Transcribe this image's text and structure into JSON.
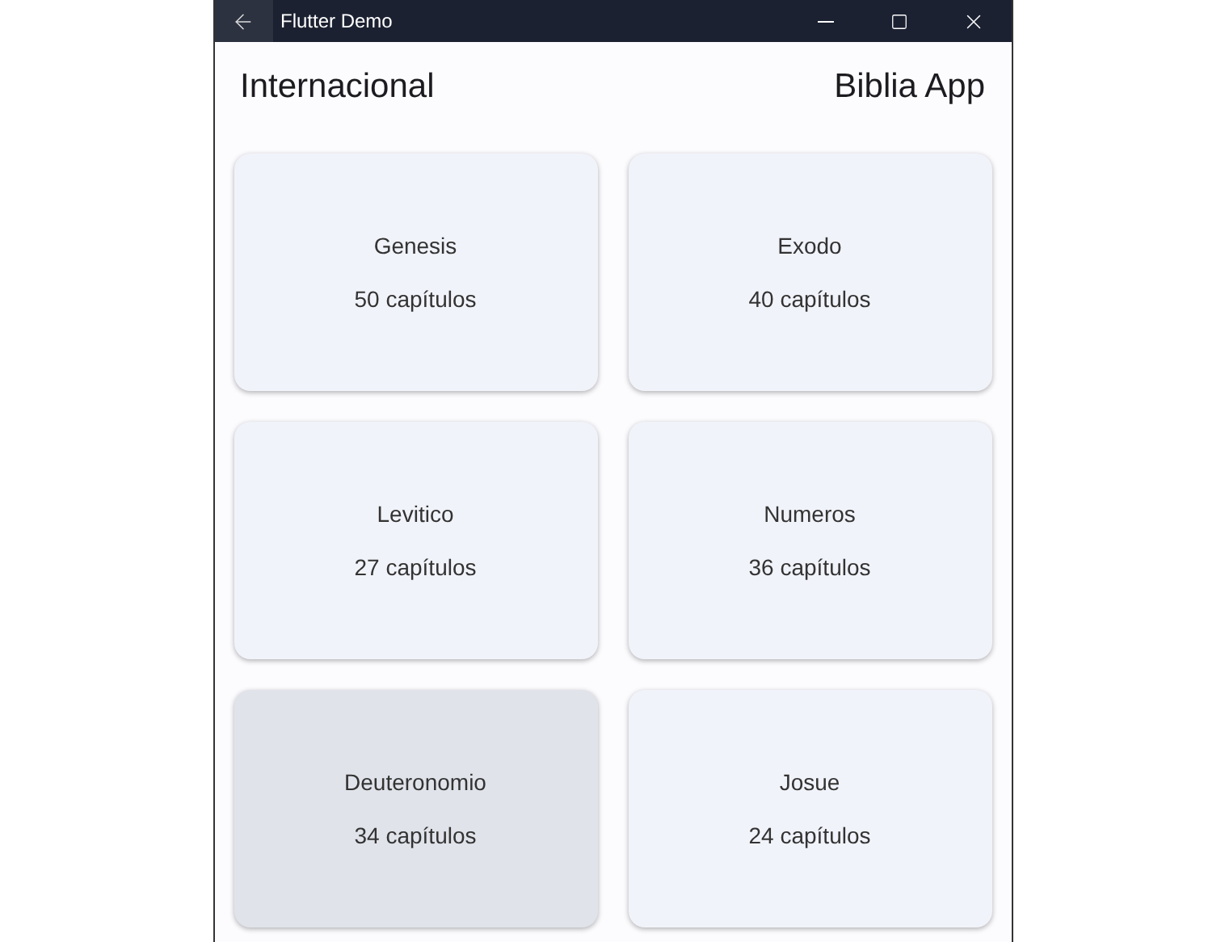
{
  "window": {
    "title": "Flutter Demo"
  },
  "header": {
    "left": "Internacional",
    "right": "Biblia App"
  },
  "books": [
    {
      "name": "Genesis",
      "chapters": "50 capítulos",
      "highlighted": false
    },
    {
      "name": "Exodo",
      "chapters": "40 capítulos",
      "highlighted": false
    },
    {
      "name": "Levitico",
      "chapters": "27 capítulos",
      "highlighted": false
    },
    {
      "name": "Numeros",
      "chapters": "36 capítulos",
      "highlighted": false
    },
    {
      "name": "Deuteronomio",
      "chapters": "34 capítulos",
      "highlighted": true
    },
    {
      "name": "Josue",
      "chapters": "24 capítulos",
      "highlighted": false
    }
  ]
}
